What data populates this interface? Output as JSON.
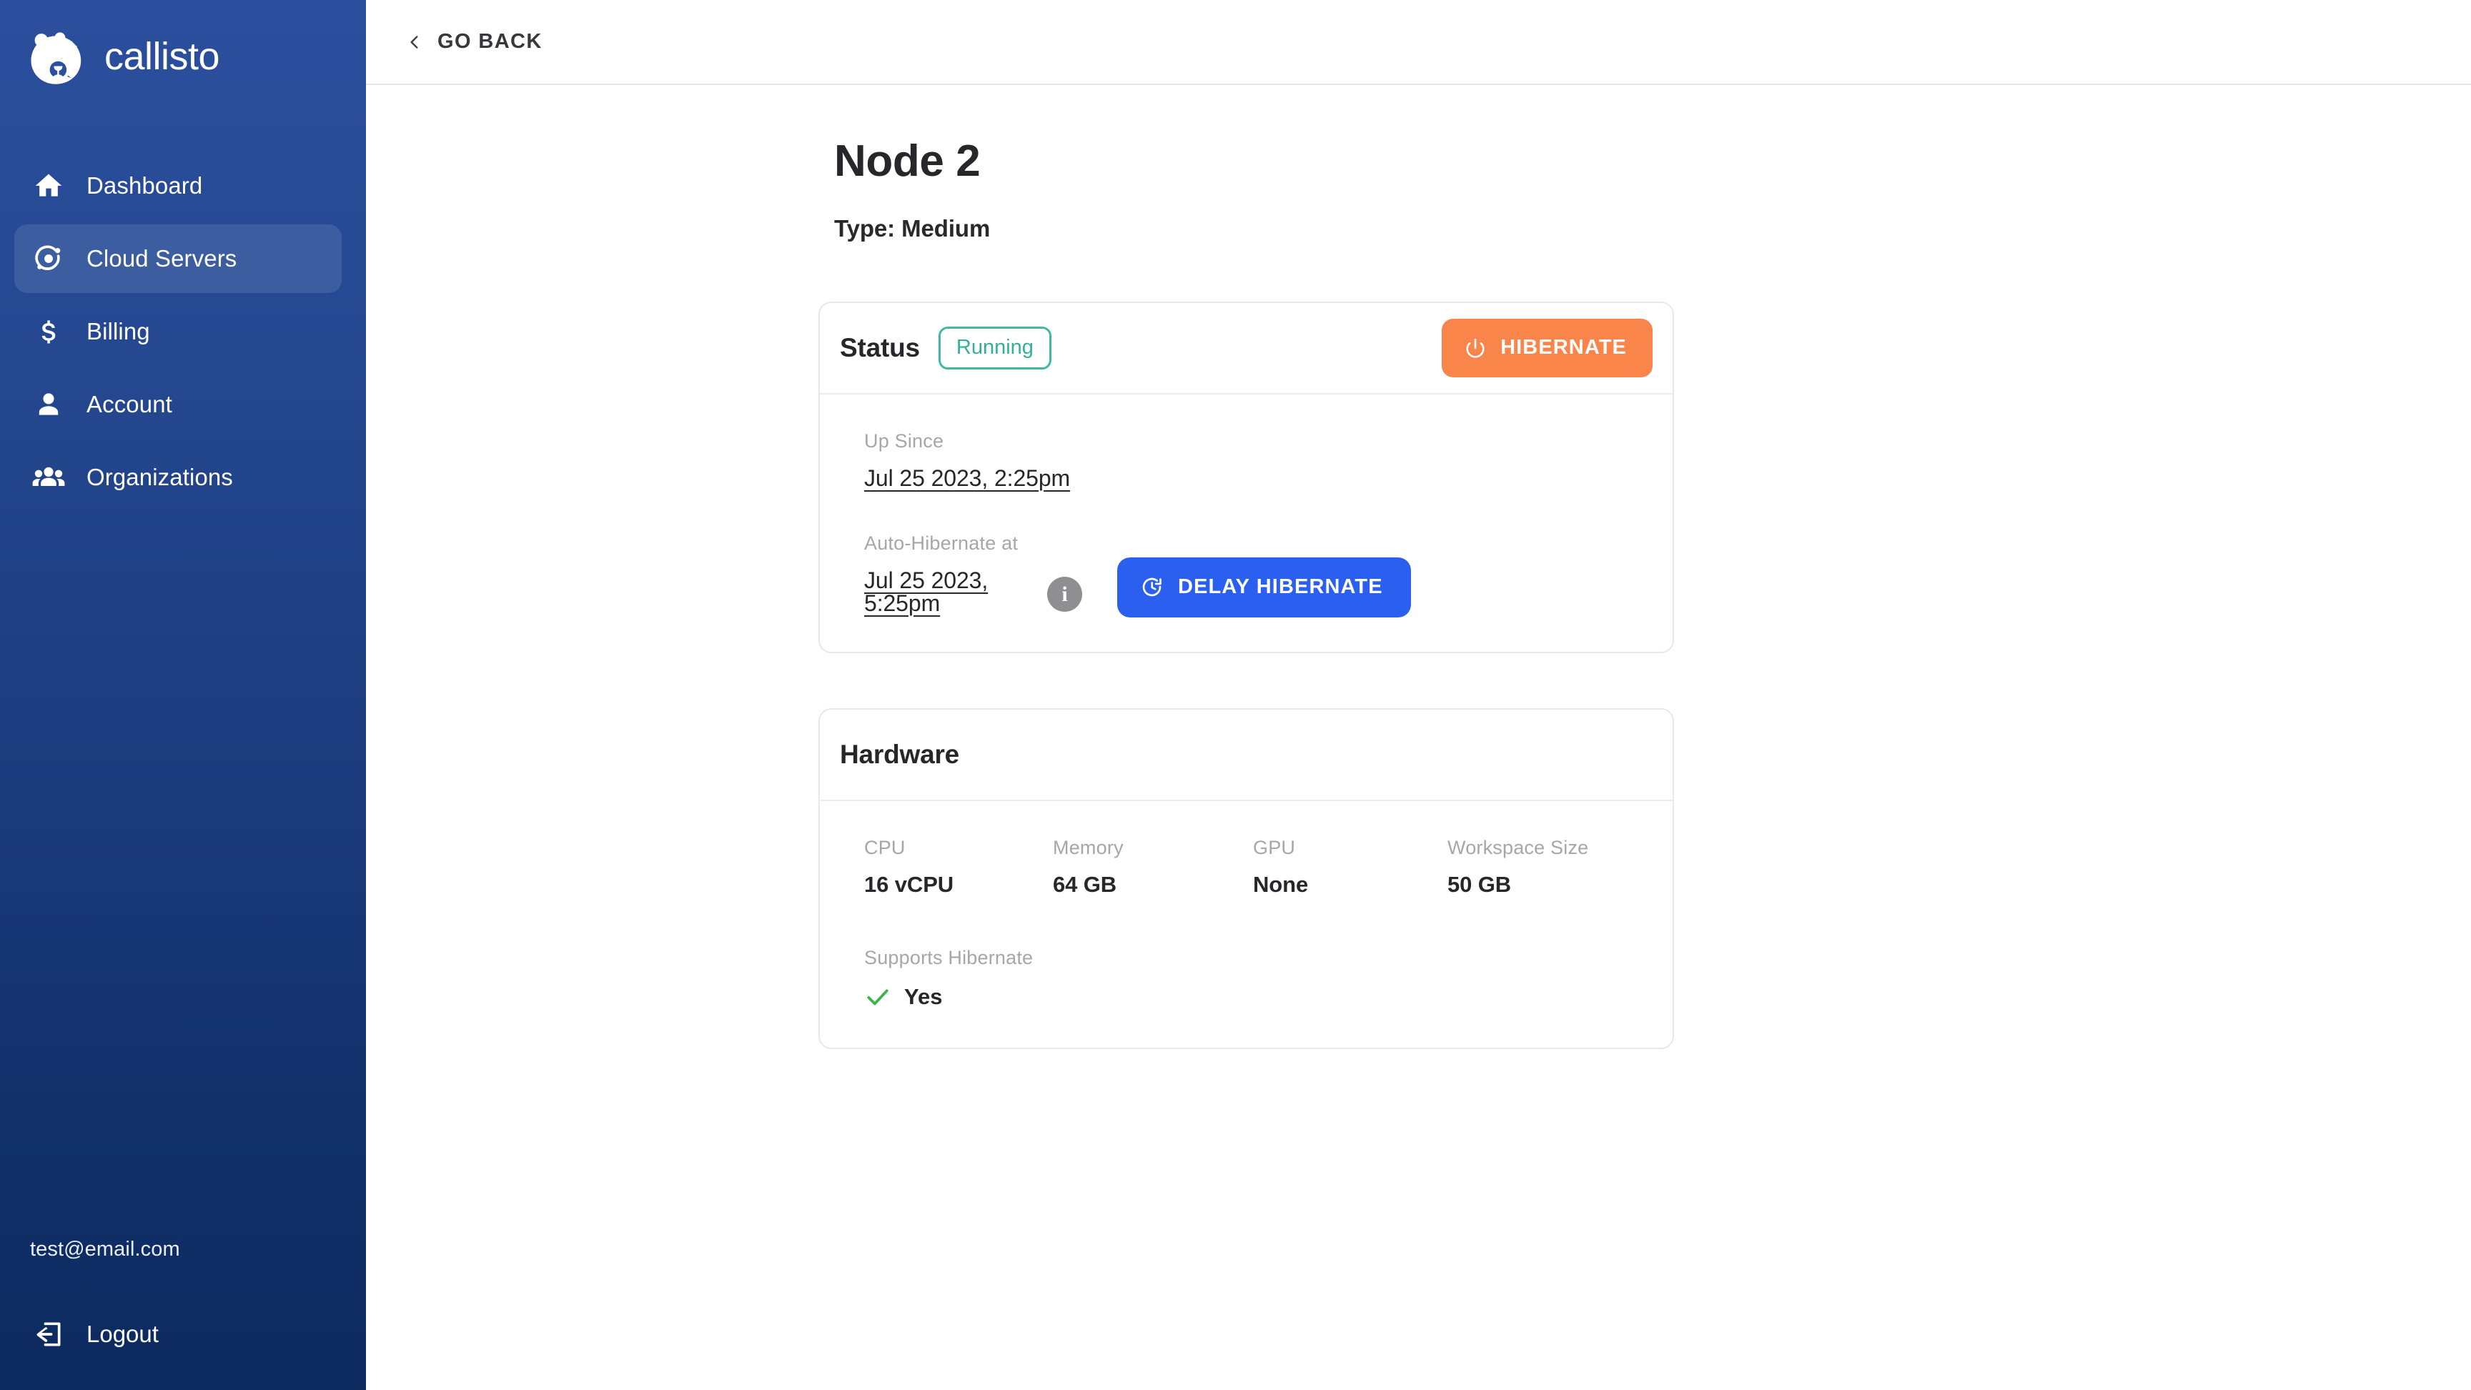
{
  "brand": {
    "name": "callisto",
    "logo_icon": "bear-moon-logo-icon"
  },
  "sidebar": {
    "items": [
      {
        "label": "Dashboard",
        "icon": "home-icon",
        "active": false
      },
      {
        "label": "Cloud Servers",
        "icon": "orbit-icon",
        "active": true
      },
      {
        "label": "Billing",
        "icon": "dollar-sign-icon",
        "active": false
      },
      {
        "label": "Account",
        "icon": "person-icon",
        "active": false
      },
      {
        "label": "Organizations",
        "icon": "people-group-icon",
        "active": false
      }
    ],
    "user_email": "test@email.com",
    "logout_label": "Logout",
    "logout_icon": "logout-icon"
  },
  "topbar": {
    "go_back_label": "GO BACK",
    "go_back_icon": "chevron-left-icon"
  },
  "page": {
    "title": "Node 2",
    "subtitle": "Type: Medium"
  },
  "status_card": {
    "title": "Status",
    "badge": "Running",
    "hibernate_button": {
      "label": "HIBERNATE",
      "icon": "power-icon"
    },
    "up_since": {
      "label": "Up Since",
      "value": "Jul 25 2023, 2:25pm"
    },
    "auto_hibernate": {
      "label": "Auto-Hibernate at",
      "value": "Jul 25 2023, 5:25pm",
      "info_icon": "info-icon",
      "info_glyph": "i"
    },
    "delay_button": {
      "label": "DELAY HIBERNATE",
      "icon": "clock-refresh-icon"
    }
  },
  "hardware_card": {
    "title": "Hardware",
    "specs": [
      {
        "label": "CPU",
        "value": "16 vCPU"
      },
      {
        "label": "Memory",
        "value": "64 GB"
      },
      {
        "label": "GPU",
        "value": "None"
      },
      {
        "label": "Workspace Size",
        "value": "50 GB"
      }
    ],
    "supports_hibernate": {
      "label": "Supports Hibernate",
      "value": "Yes",
      "icon": "check-icon"
    }
  },
  "colors": {
    "sidebar_top": "#2c4f9e",
    "sidebar_bottom": "#0c2a5e",
    "sidebar_active": "#3d5da1",
    "status_running": "#31b196",
    "hibernate_orange": "#f9854b",
    "delay_blue": "#2a5ff0",
    "check_green": "#3ab54a",
    "info_gray": "#8e8e93"
  }
}
